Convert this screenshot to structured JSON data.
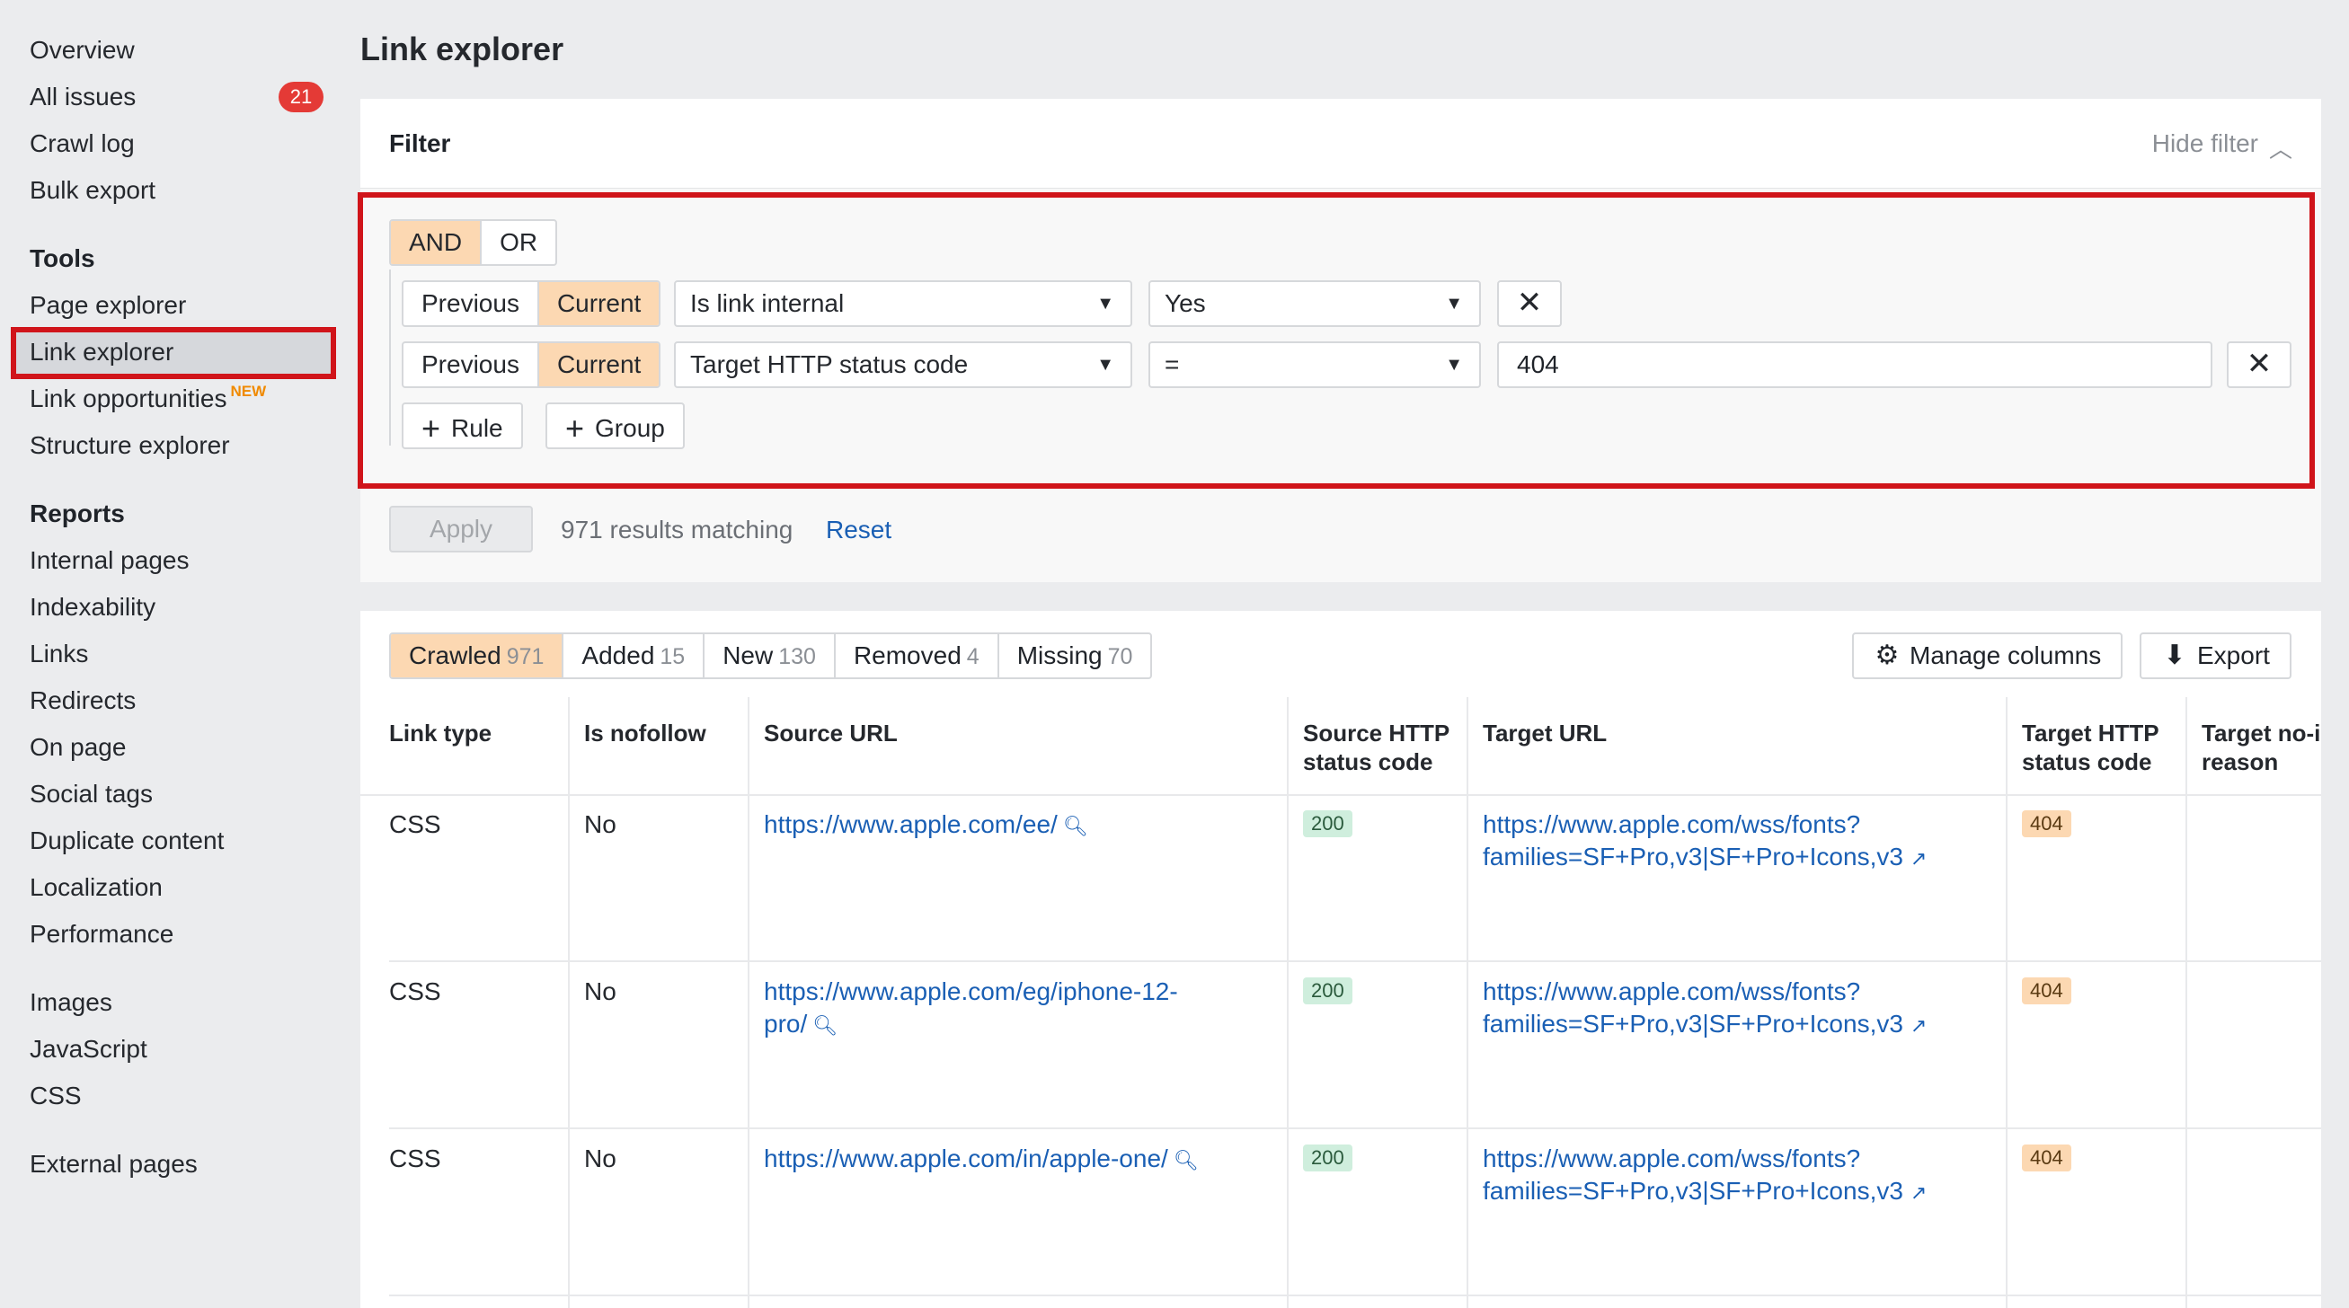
{
  "sidebar": {
    "items_top": [
      "Overview",
      "All issues",
      "Crawl log",
      "Bulk export"
    ],
    "all_issues_count": "21",
    "tools_heading": "Tools",
    "tools": [
      "Page explorer",
      "Link explorer",
      "Link opportunities",
      "Structure explorer"
    ],
    "new_tag": "NEW",
    "reports_heading": "Reports",
    "reports": [
      "Internal pages",
      "Indexability",
      "Links",
      "Redirects",
      "On page",
      "Social tags",
      "Duplicate content",
      "Localization",
      "Performance"
    ],
    "resources": [
      "Images",
      "JavaScript",
      "CSS"
    ],
    "external": "External pages"
  },
  "page": {
    "title": "Link explorer"
  },
  "filter": {
    "title": "Filter",
    "hide_label": "Hide filter",
    "logic": {
      "and": "AND",
      "or": "OR",
      "selected": "AND"
    },
    "rules": [
      {
        "previous": "Previous",
        "current": "Current",
        "field": "Is link internal",
        "value": "Yes"
      },
      {
        "previous": "Previous",
        "current": "Current",
        "field": "Target HTTP status code",
        "operator": "=",
        "value": "404"
      }
    ],
    "add_rule": "Rule",
    "add_group": "Group",
    "apply": "Apply",
    "results": "971 results matching",
    "reset": "Reset"
  },
  "tabs": [
    {
      "label": "Crawled",
      "count": "971",
      "active": true
    },
    {
      "label": "Added",
      "count": "15"
    },
    {
      "label": "New",
      "count": "130"
    },
    {
      "label": "Removed",
      "count": "4"
    },
    {
      "label": "Missing",
      "count": "70"
    }
  ],
  "toolbar": {
    "manage_columns": "Manage columns",
    "export": "Export"
  },
  "table": {
    "headers": {
      "link_type": "Link type",
      "nofollow": "Is nofollow",
      "source_url": "Source URL",
      "source_status_1": "Source HTTP",
      "source_status_2": "status code",
      "target_url": "Target URL",
      "target_status_1": "Target HTTP",
      "target_status_2": "status code",
      "target_noindex_1": "Target no-i",
      "target_noindex_2": "reason"
    },
    "rows": [
      {
        "link_type": "CSS",
        "nofollow": "No",
        "source_url_1": "https://www.apple.com/ee/",
        "source_url_2": "",
        "source_status": "200",
        "target_url_1": "https://www.apple.com/wss/fonts?",
        "target_url_2": "families=SF+Pro,v3|SF+Pro+Icons,v3",
        "target_status": "404"
      },
      {
        "link_type": "CSS",
        "nofollow": "No",
        "source_url_1": "https://www.apple.com/eg/iphone-12-",
        "source_url_2": "pro/",
        "source_status": "200",
        "target_url_1": "https://www.apple.com/wss/fonts?",
        "target_url_2": "families=SF+Pro,v3|SF+Pro+Icons,v3",
        "target_status": "404"
      },
      {
        "link_type": "CSS",
        "nofollow": "No",
        "source_url_1": "https://www.apple.com/in/apple-one/",
        "source_url_2": "",
        "source_status": "200",
        "target_url_1": "https://www.apple.com/wss/fonts?",
        "target_url_2": "families=SF+Pro,v3|SF+Pro+Icons,v3",
        "target_status": "404"
      }
    ]
  },
  "colors": {
    "accent": "#fcd8b2",
    "highlight_border": "#d0141a",
    "link": "#1a5fb4",
    "badge": "#e43a36"
  },
  "icons": {
    "search": "magnifier-icon",
    "external": "external-link-icon",
    "settings": "gear-icon",
    "export": "download-icon",
    "close": "close-icon",
    "chevron": "chevron-up-icon"
  }
}
